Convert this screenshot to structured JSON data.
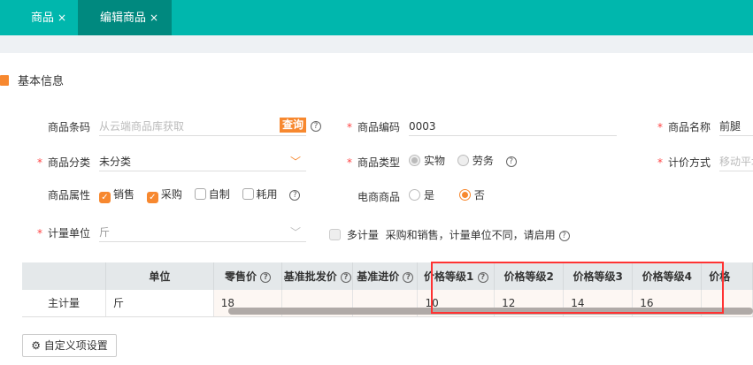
{
  "tabs": [
    {
      "label": "商品",
      "close": "×"
    },
    {
      "label": "编辑商品",
      "close": "×",
      "active": true
    }
  ],
  "colors": {
    "brand": "#00b7ad",
    "tab_active": "#00897f",
    "accent": "#f7882f",
    "required": "#ff4444",
    "highlight_box": "#ff3333"
  },
  "section": {
    "title": "基本信息",
    "icon": "document-icon"
  },
  "form": {
    "barcode": {
      "label": "商品条码",
      "placeholder": "从云端商品库获取",
      "query": "查询"
    },
    "code": {
      "label": "商品编码",
      "value": "0003"
    },
    "name": {
      "label": "商品名称",
      "value": "前腿肉,"
    },
    "category": {
      "label": "商品分类",
      "value": "未分类"
    },
    "type": {
      "label": "商品类型",
      "options": [
        "实物",
        "劳务"
      ],
      "selected": "实物"
    },
    "pricing": {
      "label": "计价方式",
      "placeholder": "移动平均"
    },
    "attrs": {
      "label": "商品属性",
      "options": [
        {
          "label": "销售",
          "checked": true
        },
        {
          "label": "采购",
          "checked": true
        },
        {
          "label": "自制",
          "checked": false
        },
        {
          "label": "耗用",
          "checked": false
        }
      ]
    },
    "ecommerce": {
      "label": "电商商品",
      "options": [
        "是",
        "否"
      ],
      "selected": "否"
    },
    "unit": {
      "label": "计量单位",
      "value": "斤"
    },
    "multi_unit": {
      "label": "多计量",
      "hint": "采购和销售，计量单位不同，请启用",
      "checked": false
    }
  },
  "table": {
    "headers": [
      "",
      "单位",
      "零售价",
      "基准批发价",
      "基准进价",
      "价格等级1",
      "价格等级2",
      "价格等级3",
      "价格等级4",
      "价格"
    ],
    "row": [
      "主计量",
      "斤",
      "18",
      "",
      "",
      "10",
      "12",
      "14",
      "16",
      ""
    ]
  },
  "custom_button": "自定义项设置",
  "help": "?"
}
